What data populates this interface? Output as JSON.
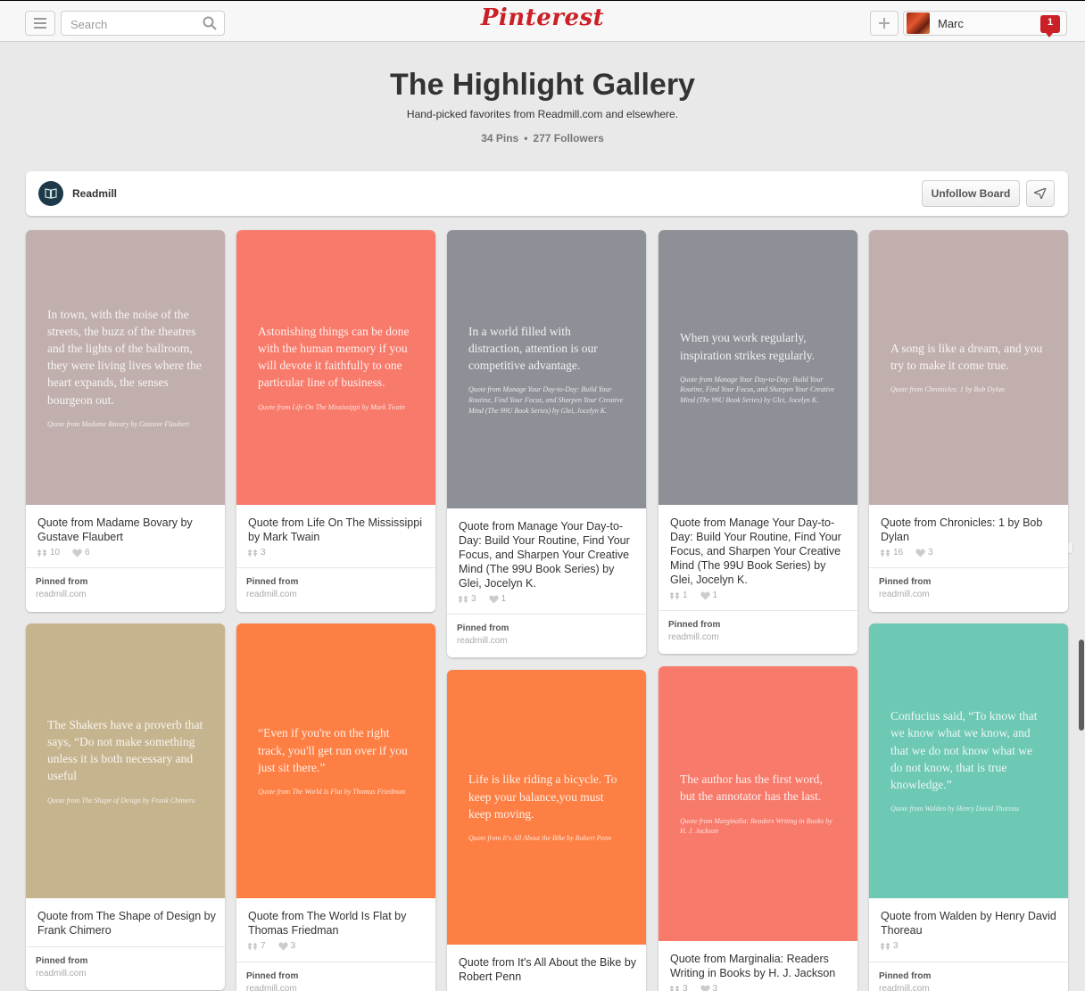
{
  "header": {
    "search_placeholder": "Search",
    "logo": "Pinterest",
    "user_name": "Marc",
    "notification_count": "1"
  },
  "board": {
    "title": "The Highlight Gallery",
    "description": "Hand-picked favorites from Readmill.com and elsewhere.",
    "pins_count": "34 Pins",
    "followers_count": "277 Followers",
    "owner": "Readmill",
    "unfollow_label": "Unfollow Board"
  },
  "pins": [
    {
      "bg": "#c1afae",
      "quote": "In town, with the noise of the streets, the buzz of the theatres and the lights of the ballroom, they were living lives where the heart expands, the senses bourgeon out.",
      "cite": "Quote from Madame Bovary by Gustave Flaubert",
      "desc": "Quote from Madame Bovary by Gustave Flaubert",
      "repins": "10",
      "likes": "6",
      "pinned_from": "Pinned from",
      "domain": "readmill.com"
    },
    {
      "bg": "#f87a6a",
      "quote": "Astonishing things can be done with the human memory if you will devote it faithfully to one particular line of business.",
      "cite": "Quote from Life On The Mississippi by Mark Twain",
      "desc": "Quote from Life On The Mississippi by Mark Twain",
      "repins": "3",
      "likes": "",
      "pinned_from": "Pinned from",
      "domain": "readmill.com"
    },
    {
      "bg": "#8d9096",
      "quote": "In a world filled with distraction, attention is our competitive advantage.",
      "cite": "Quote from Manage Your Day-to-Day: Build Your Routine, Find Your Focus, and Sharpen Your Creative Mind (The 99U Book Series) by Glei, Jocelyn K.",
      "desc": "Quote from Manage Your Day-to-Day: Build Your Routine, Find Your Focus, and Sharpen Your Creative Mind (The 99U Book Series) by Glei, Jocelyn K.",
      "repins": "3",
      "likes": "1",
      "pinned_from": "Pinned from",
      "domain": "readmill.com"
    },
    {
      "bg": "#8d9096",
      "quote": "When you work regularly, inspiration strikes regularly.",
      "cite": "Quote from Manage Your Day-to-Day: Build Your Routine, Find Your Focus, and Sharpen Your Creative Mind (The 99U Book Series) by Glei, Jocelyn K.",
      "desc": "Quote from Manage Your Day-to-Day: Build Your Routine, Find Your Focus, and Sharpen Your Creative Mind (The 99U Book Series) by Glei, Jocelyn K.",
      "repins": "1",
      "likes": "1",
      "pinned_from": "Pinned from",
      "domain": "readmill.com"
    },
    {
      "bg": "#c1afae",
      "quote": "A song is like a dream, and you try to make it come true.",
      "cite": "Quote from Chronicles: 1 by Bob Dylan",
      "desc": "Quote from Chronicles: 1 by Bob Dylan",
      "repins": "16",
      "likes": "3",
      "pinned_from": "Pinned from",
      "domain": "readmill.com"
    },
    {
      "bg": "#c6b48e",
      "quote": "The Shakers have a proverb that says, “Do not make something unless it is both necessary and useful",
      "cite": "Quote from The Shape of Design by Frank Chimero",
      "desc": "Quote from The Shape of Design by Frank Chimero",
      "repins": "",
      "likes": "",
      "pinned_from": "Pinned from",
      "domain": "readmill.com"
    },
    {
      "bg": "#fd7f43",
      "quote": "“Even if you're on the right track, you'll get run over if you just sit there.”",
      "cite": "Quote from The World Is Flat by Thomas Friedman",
      "desc": "Quote from The World Is Flat by Thomas Friedman",
      "repins": "7",
      "likes": "3",
      "pinned_from": "Pinned from",
      "domain": "readmill.com"
    },
    {
      "bg": "#fd7f43",
      "quote": "Life is like riding a bicycle. To keep your balance,you must keep moving.",
      "cite": "Quote from It's All About the Bike by Robert Penn",
      "desc": "Quote from It's All About the Bike by Robert Penn",
      "repins": "",
      "likes": "",
      "pinned_from": "",
      "domain": ""
    },
    {
      "bg": "#f87a6a",
      "quote": "The author has the first word, but the annotator has the last.",
      "cite": "Quote from Marginalia: Readers Writing in Books by H. J. Jackson",
      "desc": "Quote from Marginalia: Readers Writing in Books by H. J. Jackson",
      "repins": "3",
      "likes": "3",
      "pinned_from": "",
      "domain": ""
    },
    {
      "bg": "#6dc8b4",
      "quote": "Confucius said, “To know that we know what we know, and that we do not know what we do not know, that is true knowledge.”",
      "cite": "Quote from Walden by Henry David Thoreau",
      "desc": "Quote from Walden by Henry David Thoreau",
      "repins": "3",
      "likes": "",
      "pinned_from": "Pinned from",
      "domain": "readmill.com"
    }
  ]
}
